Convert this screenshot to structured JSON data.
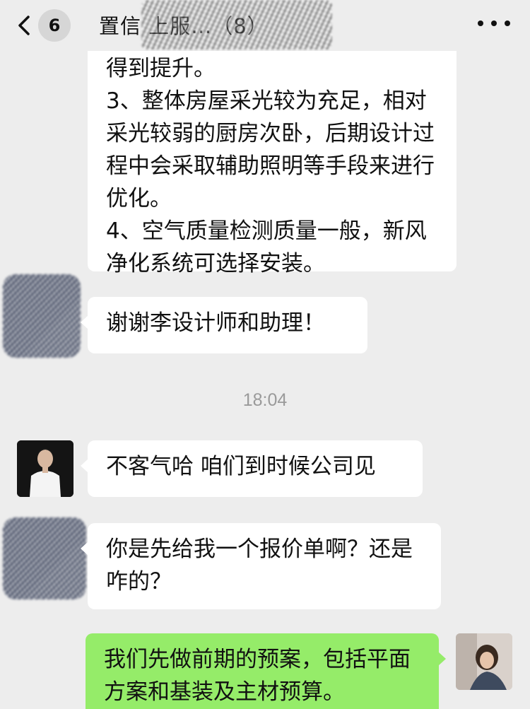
{
  "header": {
    "back_icon": "chevron-left-icon",
    "unread_count": "6",
    "title_visible": "置信                    上服…（8）",
    "more_icon": "more-dots-icon"
  },
  "messages": [
    {
      "side": "left",
      "text": "得到提升。\n3、整体房屋采光较为充足，相对采光较弱的厨房次卧，后期设计过程中会采取辅助照明等手段来进行优化。\n4、空气质量检测质量一般，新风净化系统可选择安装。"
    },
    {
      "side": "left",
      "text": "谢谢李设计师和助理！"
    },
    {
      "side": "left",
      "text": "不客气哈 咱们到时候公司见"
    },
    {
      "side": "left",
      "text": "你是先给我一个报价单啊？还是咋的？"
    },
    {
      "side": "right",
      "text": "我们先做前期的预案，包括平面方案和基装及主材预算。"
    }
  ],
  "timestamp": "18:04",
  "colors": {
    "background": "#ededed",
    "incoming_bubble": "#ffffff",
    "outgoing_bubble": "#95ec69",
    "timestamp_text": "#9a9a9a"
  }
}
